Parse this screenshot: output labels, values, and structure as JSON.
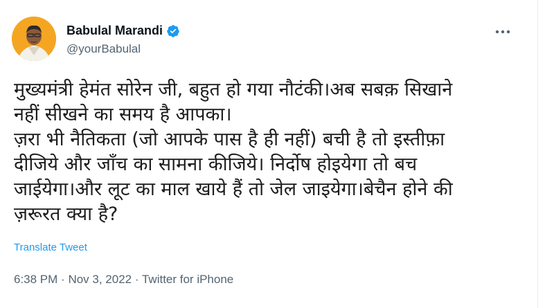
{
  "author": {
    "name": "Babulal Marandi",
    "handle": "@yourBabulal",
    "verified": true
  },
  "tweet": {
    "lines": [
      "मुख्यमंत्री हेमंत सोरेन जी, बहुत हो गया नौटंकी।अब सबक़ सिखाने",
      "नहीं सीखने का समय है आपका।",
      "ज़रा भी नैतिकता (जो आपके पास है ही नहीं) बची है तो इस्तीफ़ा",
      "दीजिये और जाँच का सामना कीजिये। निर्दोष होइयेगा तो बच",
      "जाईयेगा।और लूट का माल खाये हैं तो जेल जाइयेगा।बेचैन होने की",
      "ज़रूरत क्या है?"
    ],
    "translate_label": "Translate Tweet",
    "time": "6:38 PM",
    "separator": "·",
    "date": "Nov 3, 2022",
    "source": "Twitter for iPhone"
  },
  "icons": {
    "verified": "verified-badge-icon",
    "more": "more-options-icon"
  },
  "colors": {
    "verified": "#1d9bf0",
    "link": "#1d9bf0",
    "secondary_text": "#536471",
    "avatar_bg": "#f4a623"
  }
}
